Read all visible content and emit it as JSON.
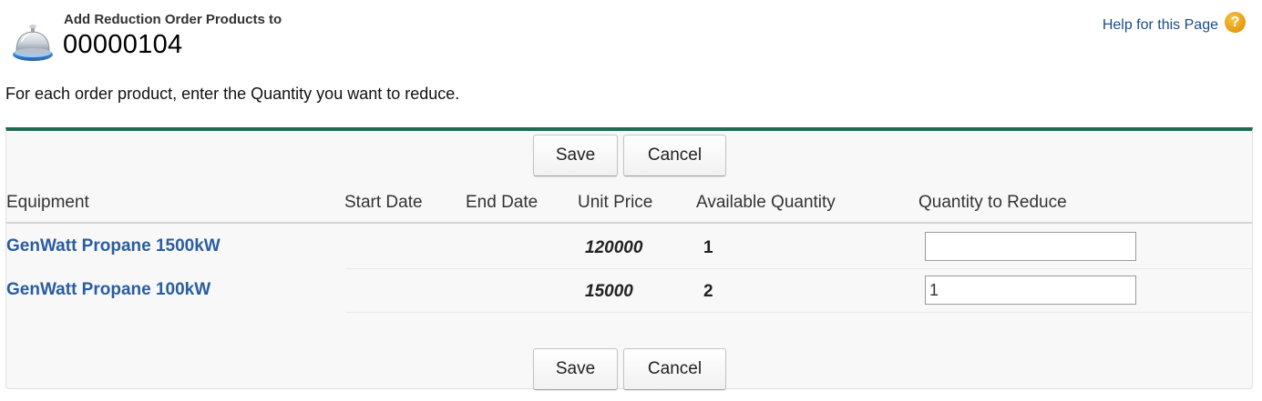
{
  "header": {
    "subtitle": "Add Reduction Order Products to",
    "title": "00000104",
    "help_link": "Help for this Page",
    "help_icon": "?"
  },
  "instruction": "For each order product, enter the Quantity you want to reduce.",
  "buttons": {
    "save": "Save",
    "cancel": "Cancel"
  },
  "table": {
    "columns": [
      "Equipment",
      "Start Date",
      "End Date",
      "Unit Price",
      "Available Quantity",
      "Quantity to Reduce"
    ],
    "rows": [
      {
        "equipment": "GenWatt Propane 1500kW",
        "start_date": "",
        "end_date": "",
        "unit_price": "120000",
        "available_quantity": "1",
        "quantity_to_reduce": ""
      },
      {
        "equipment": "GenWatt Propane 100kW",
        "start_date": "",
        "end_date": "",
        "unit_price": "15000",
        "available_quantity": "2",
        "quantity_to_reduce": "1"
      }
    ]
  },
  "colors": {
    "accent": "#1f6b4f",
    "link": "#2a5d9f",
    "help_icon": "#e69a10"
  },
  "icons": {
    "header": "service-bell-icon",
    "help": "help-question-icon"
  }
}
